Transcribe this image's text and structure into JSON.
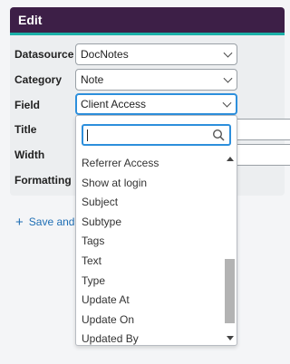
{
  "panel": {
    "title": "Edit"
  },
  "form": {
    "datasource": {
      "label": "Datasource",
      "value": "DocNotes"
    },
    "category": {
      "label": "Category",
      "value": "Note"
    },
    "field": {
      "label": "Field",
      "value": "Client Access"
    },
    "title": {
      "label": "Title"
    },
    "width": {
      "label": "Width"
    },
    "formatting": {
      "label": "Formatting"
    }
  },
  "save_link": {
    "icon": "+",
    "label": "Save and"
  },
  "dropdown": {
    "search_value": "",
    "items": [
      "Referrer Access",
      "Show at login",
      "Subject",
      "Subtype",
      "Tags",
      "Text",
      "Type",
      "Update At",
      "Update On",
      "Updated By"
    ]
  },
  "colors": {
    "header_bg": "#3d1f47",
    "header_accent": "#1bb0a8",
    "focus": "#2d8fdc",
    "link": "#1f6fb5"
  }
}
